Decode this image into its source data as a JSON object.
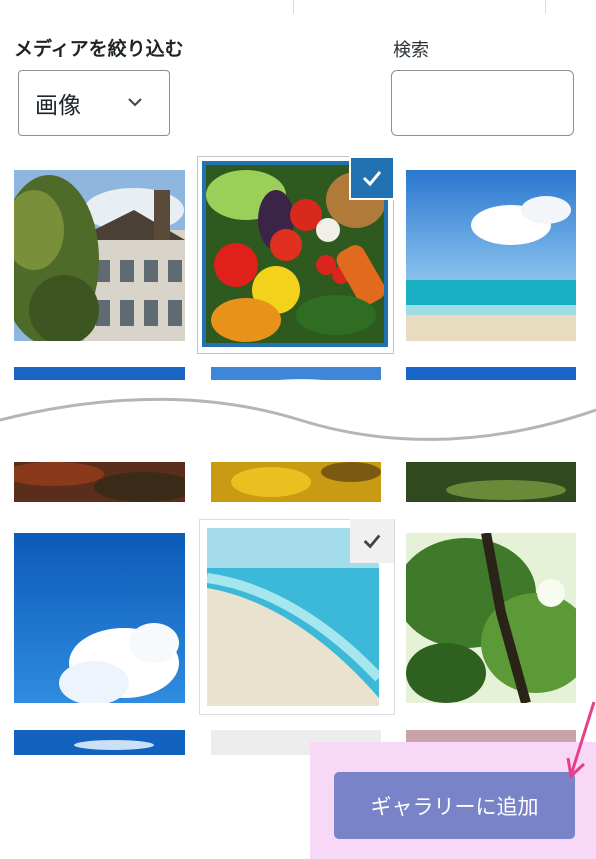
{
  "media_filter": {
    "label": "メディアを絞り込む",
    "selected_value": "画像"
  },
  "search": {
    "label": "検索",
    "value": ""
  },
  "footer": {
    "add_button_label": "ギャラリーに追加"
  },
  "colors": {
    "accent": "#2271b1",
    "button": "#7983c7",
    "highlight": "#f7d8f7",
    "annotation_arrow": "#e83e8c"
  },
  "thumbnails": [
    {
      "subject": "old-building",
      "selected": false
    },
    {
      "subject": "vegetables",
      "selected": true
    },
    {
      "subject": "beach-sky",
      "selected": false
    },
    {
      "subject": "autumn-forest",
      "selected": false
    },
    {
      "subject": "yellow-ginkgo",
      "selected": false
    },
    {
      "subject": "green-garden",
      "selected": false
    },
    {
      "subject": "blue-sky-clouds",
      "selected": false
    },
    {
      "subject": "white-sand-beach",
      "selected": true
    },
    {
      "subject": "green-tree",
      "selected": false
    }
  ]
}
